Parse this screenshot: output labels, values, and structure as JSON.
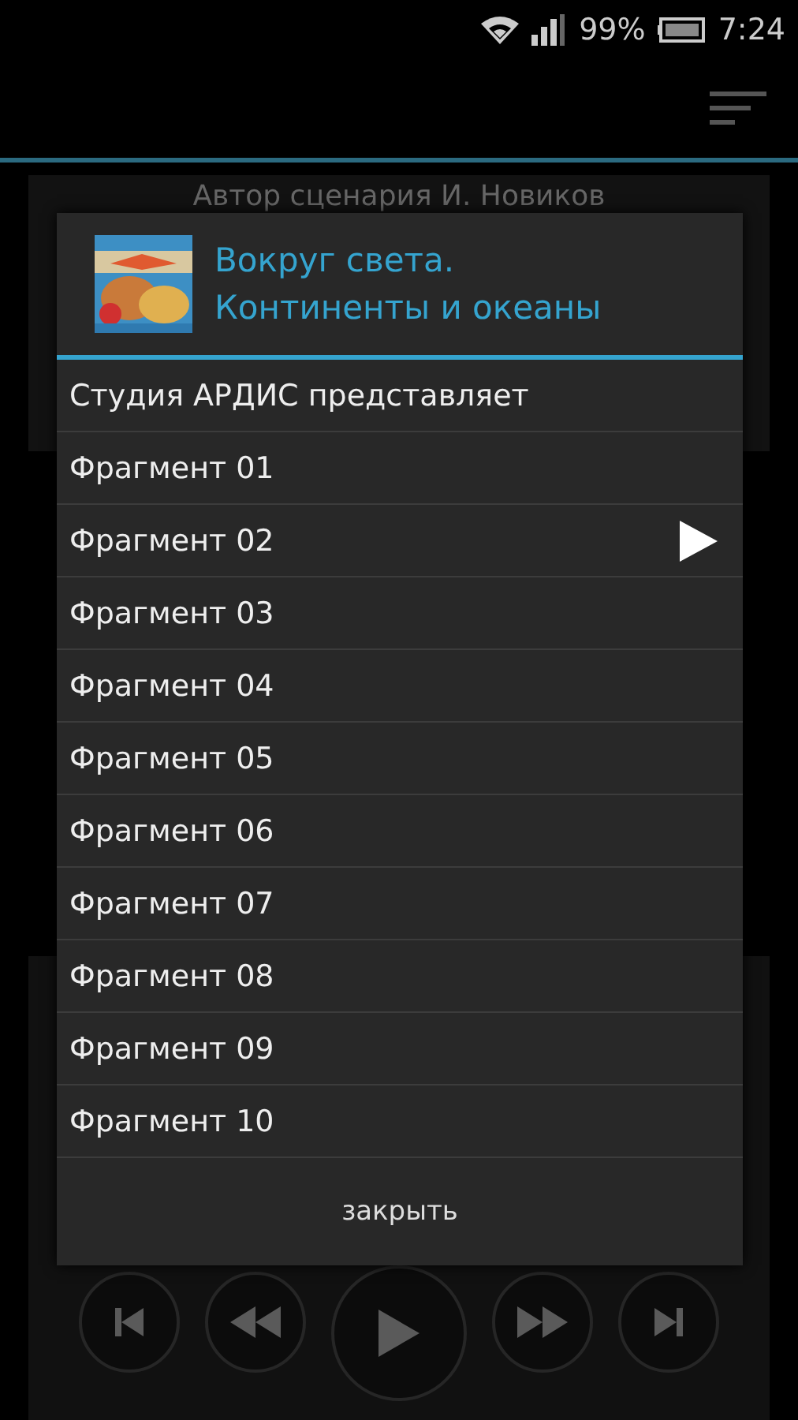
{
  "status_bar": {
    "battery": "99%",
    "time": "7:24"
  },
  "background": {
    "caption": "Автор сценария И. Новиков"
  },
  "dialog": {
    "title_lines": [
      "Вокруг света.",
      "Континенты и океаны"
    ],
    "items": [
      {
        "label": "Студия АРДИС представляет",
        "playing": false
      },
      {
        "label": "Фрагмент 01",
        "playing": false
      },
      {
        "label": "Фрагмент 02",
        "playing": true
      },
      {
        "label": "Фрагмент 03",
        "playing": false
      },
      {
        "label": "Фрагмент 04",
        "playing": false
      },
      {
        "label": "Фрагмент 05",
        "playing": false
      },
      {
        "label": "Фрагмент 06",
        "playing": false
      },
      {
        "label": "Фрагмент 07",
        "playing": false
      },
      {
        "label": "Фрагмент 08",
        "playing": false
      },
      {
        "label": "Фрагмент 09",
        "playing": false
      },
      {
        "label": "Фрагмент 10",
        "playing": false
      }
    ],
    "close_button": "закрыть"
  },
  "controls": [
    {
      "kind": "previous"
    },
    {
      "kind": "rewind"
    },
    {
      "kind": "play"
    },
    {
      "kind": "forward"
    },
    {
      "kind": "next"
    }
  ]
}
